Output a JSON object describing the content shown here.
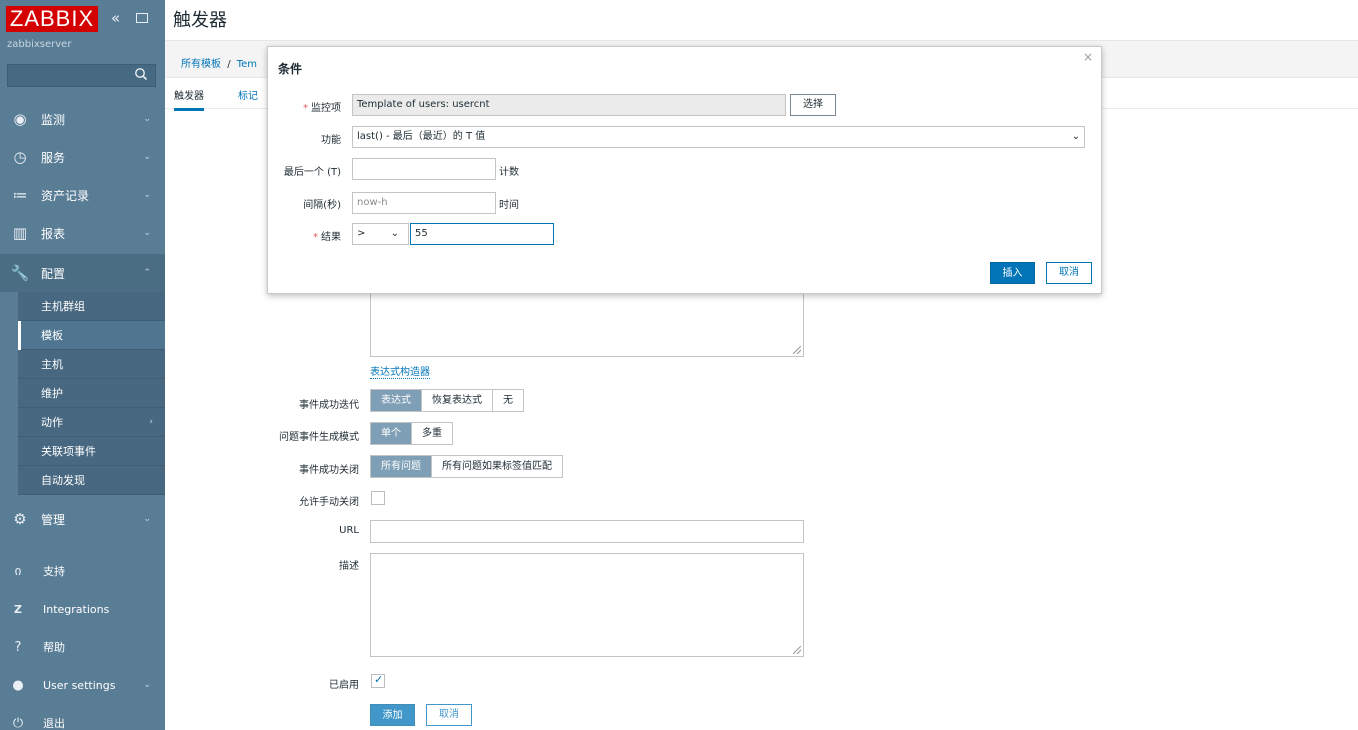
{
  "app": {
    "logo": "ZABBIX",
    "server": "zabbixserver",
    "page_title": "触发器"
  },
  "sidebar": {
    "menu": [
      {
        "label": "监测",
        "icon": "eye-icon"
      },
      {
        "label": "服务",
        "icon": "clock-icon"
      },
      {
        "label": "资产记录",
        "icon": "list-icon"
      },
      {
        "label": "报表",
        "icon": "bar-chart-icon"
      },
      {
        "label": "配置",
        "icon": "wrench-icon"
      },
      {
        "label": "管理",
        "icon": "gear-icon"
      }
    ],
    "config_submenu": [
      "主机群组",
      "模板",
      "主机",
      "维护",
      "动作",
      "关联项事件",
      "自动发现"
    ],
    "bottom": [
      {
        "label": "支持",
        "icon": "headset-icon"
      },
      {
        "label": "Integrations",
        "icon": "z-icon"
      },
      {
        "label": "帮助",
        "icon": "help-icon"
      },
      {
        "label": "User settings",
        "icon": "user-icon"
      },
      {
        "label": "退出",
        "icon": "power-icon"
      }
    ]
  },
  "breadcrumb": {
    "root": "所有模板",
    "sep": "/",
    "current": "Tem"
  },
  "tabs": {
    "triggers": "触发器",
    "tags": "标记"
  },
  "form": {
    "expr_builder_link": "表达式构造器",
    "ok_event_generation_label": "事件成功迭代",
    "ok_event_generation_options": [
      "表达式",
      "恢复表达式",
      "无"
    ],
    "problem_mode_label": "问题事件生成模式",
    "problem_mode_options": [
      "单个",
      "多重"
    ],
    "ok_event_close_label": "事件成功关闭",
    "ok_event_close_options": [
      "所有问题",
      "所有问题如果标签值匹配"
    ],
    "manual_close_label": "允许手动关闭",
    "url_label": "URL",
    "description_label": "描述",
    "enabled_label": "已启用",
    "add_button": "添加",
    "cancel_button": "取消"
  },
  "modal": {
    "title": "条件",
    "close": "×",
    "item_label": "监控项",
    "item_value": "Template of users: usercnt",
    "select_button": "选择",
    "function_label": "功能",
    "function_value": "last() - 最后（最近）的 T 值",
    "last_t_label": "最后一个 (T)",
    "last_t_value": "",
    "last_t_suffix": "计数",
    "interval_label": "间隔(秒)",
    "interval_value": "now-h",
    "interval_suffix": "时间",
    "result_label": "结果",
    "result_operator": ">",
    "result_value": "55",
    "insert_button": "插入",
    "cancel_button": "取消"
  },
  "icons": {
    "collapse": "double-chevron-left-icon",
    "kiosk": "kiosk-icon",
    "search": "search-icon",
    "dropdown": "chevron-down-icon"
  },
  "colors": {
    "sidebar_bg": "#5a7d96",
    "logo_red": "#d40000",
    "accent_blue": "#0275b8",
    "segment_active": "#7e9fb6"
  }
}
